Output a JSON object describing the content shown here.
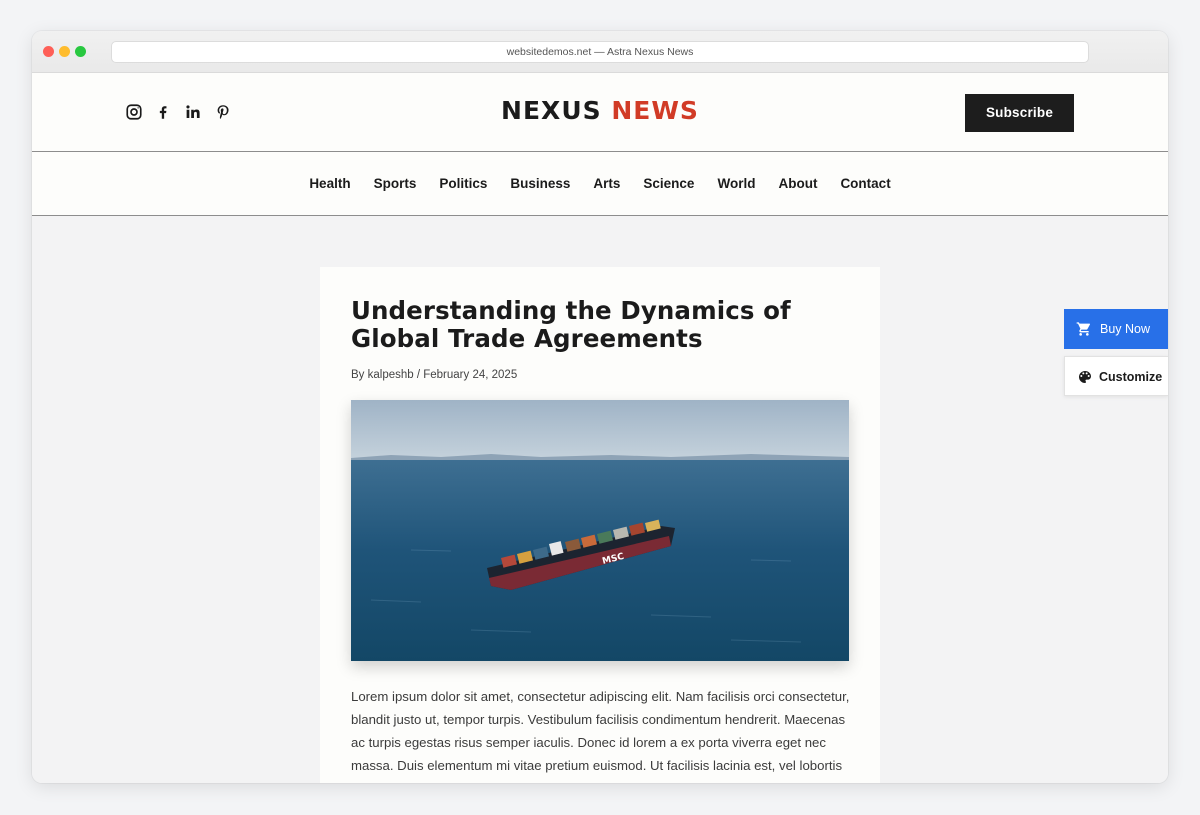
{
  "browser": {
    "url_title": "websitedemos.net — Astra Nexus News"
  },
  "header": {
    "social_icons": [
      "instagram-icon",
      "facebook-icon",
      "linkedin-icon",
      "pinterest-icon"
    ],
    "logo_main": "NEXUS",
    "logo_accent": "NEWS",
    "subscribe_label": "Subscribe"
  },
  "nav": {
    "items": [
      {
        "label": "Health"
      },
      {
        "label": "Sports"
      },
      {
        "label": "Politics"
      },
      {
        "label": "Business"
      },
      {
        "label": "Arts"
      },
      {
        "label": "Science"
      },
      {
        "label": "World"
      },
      {
        "label": "About"
      },
      {
        "label": "Contact"
      }
    ]
  },
  "article": {
    "title": "Understanding the Dynamics of Global Trade Agreements",
    "meta": "By kalpeshb / February 24, 2025",
    "hero_alt": "Container ship on open sea",
    "body": "Lorem ipsum dolor sit amet, consectetur adipiscing elit. Nam facilisis orci consectetur, blandit justo ut, tempor turpis. Vestibulum facilisis condimentum hendrerit. Maecenas ac turpis egestas risus semper iaculis. Donec id lorem a ex porta viverra eget nec massa. Duis elementum mi vitae pretium euismod. Ut facilisis lacinia est, vel lobortis"
  },
  "side_actions": {
    "buy_label": "Buy Now",
    "customize_label": "Customize"
  },
  "colors": {
    "logo_accent": "#d13b26",
    "subscribe_bg": "#1d1d1d",
    "buy_bg": "#2870e8"
  }
}
